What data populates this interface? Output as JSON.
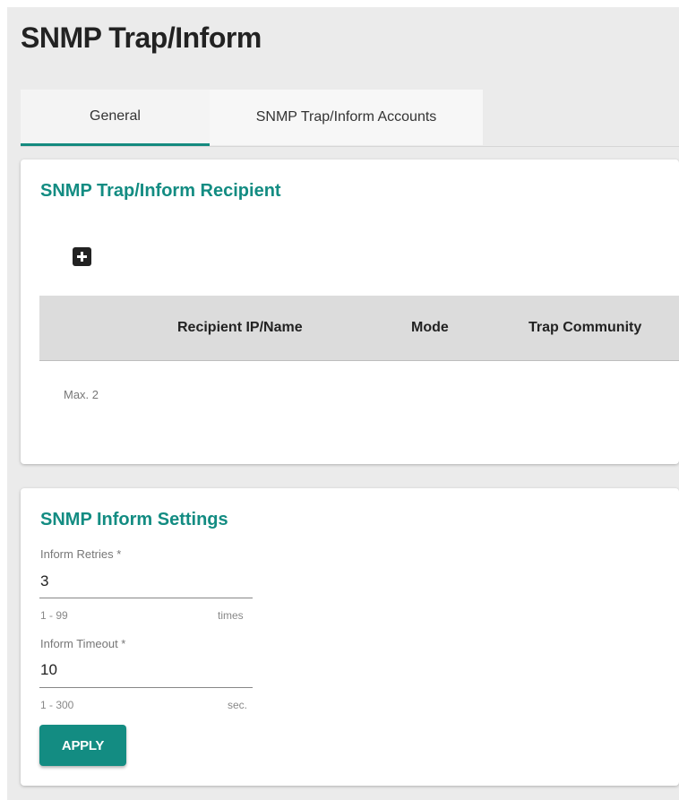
{
  "page": {
    "title": "SNMP Trap/Inform"
  },
  "tabs": [
    {
      "label": "General",
      "active": true
    },
    {
      "label": "SNMP Trap/Inform Accounts",
      "active": false
    }
  ],
  "recipient": {
    "title": "SNMP Trap/Inform Recipient",
    "add_icon": "plus-square-icon",
    "columns": [
      "Recipient IP/Name",
      "Mode",
      "Trap Community"
    ],
    "footer_text": "Max. 2"
  },
  "inform": {
    "title": "SNMP Inform Settings",
    "retries": {
      "label": "Inform Retries *",
      "value": "3",
      "range": "1 - 99",
      "unit": "times"
    },
    "timeout": {
      "label": "Inform Timeout *",
      "value": "10",
      "range": "1 - 300",
      "unit": "sec."
    },
    "apply_label": "APPLY"
  },
  "colors": {
    "accent": "#138c82",
    "background": "#ebebeb"
  }
}
